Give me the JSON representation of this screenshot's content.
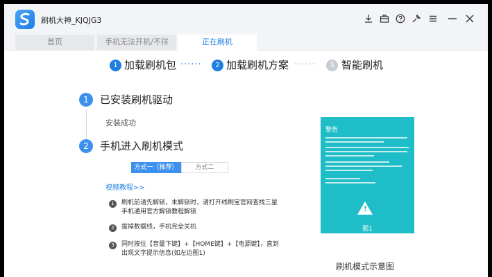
{
  "app": {
    "title": "刷机大神_KJQJG3"
  },
  "titlebar_icons": [
    "download-icon",
    "briefcase-icon",
    "help-icon",
    "wrench-icon",
    "menu-icon",
    "minimize-icon",
    "close-icon"
  ],
  "tabs": [
    {
      "label": "首页",
      "active": false
    },
    {
      "label": "手机无法开机/不徉",
      "active": false
    },
    {
      "label": "正在刷机",
      "active": true
    }
  ],
  "steps": [
    {
      "num": "1",
      "label": "加载刷机包"
    },
    {
      "num": "2",
      "label": "加载刷机方案"
    },
    {
      "num": "3",
      "label": "智能刷机"
    }
  ],
  "step_dots": "······",
  "section1": {
    "num": "1",
    "title": "已安装刷机驱动",
    "status": "安装成功"
  },
  "section2": {
    "num": "2",
    "title": "手机进入刷机模式",
    "method_tabs": [
      "方式一（推荐）",
      "方式二"
    ],
    "video_link": "视频教程>>",
    "instructions": [
      {
        "num": "1",
        "text": "刷机前请先解锁，未解锁时，请打开线刷宝官网查找三星手机通用官方解锁教程解锁"
      },
      {
        "num": "2",
        "text": "拔掉数据线，手机完全关机"
      },
      {
        "num": "3",
        "text": "同时按住【音量下键】+【HOME键】+【电源键】，直到出现文字提示信息(如左边图1)"
      }
    ]
  },
  "phone_preview": {
    "title": "警告",
    "figure_label": "图1",
    "caption": "刷机模式示意图"
  },
  "colors": {
    "accent": "#1e7fe0",
    "step_inactive": "#c8cdd3",
    "phone_bg": "#1ebdc7"
  }
}
